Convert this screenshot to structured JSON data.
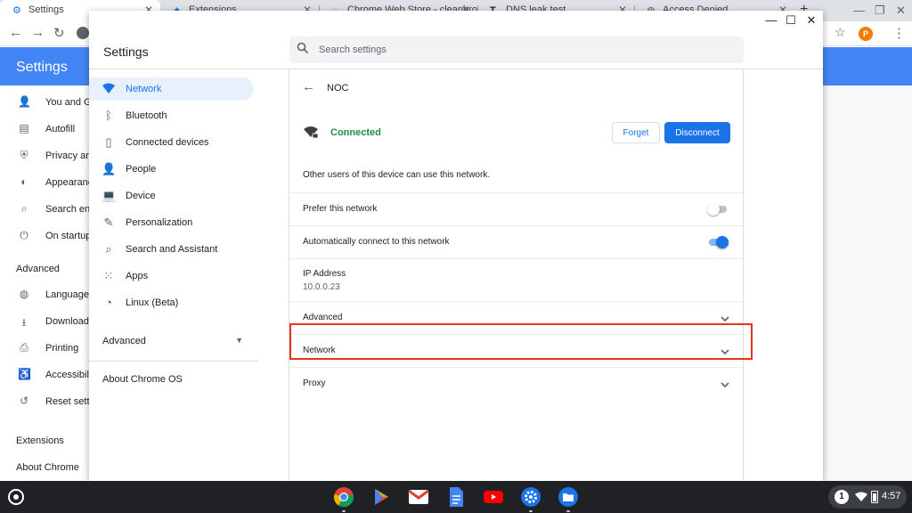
{
  "browser": {
    "tabs": [
      {
        "title": "Settings",
        "icon": "settings-gear-icon"
      },
      {
        "title": "Extensions",
        "icon": "puzzle-icon"
      },
      {
        "title": "Chrome Web Store - cleanbrow",
        "icon": "web-store-icon"
      },
      {
        "title": "DNS leak test",
        "icon": "text-icon"
      },
      {
        "title": "Access Denied",
        "icon": "globe-icon"
      }
    ],
    "new_tab": "+",
    "min_glyph": "—",
    "max_glyph": "❐",
    "close_glyph": "✕",
    "star_glyph": "☆",
    "menu_glyph": "⋮",
    "back_glyph": "←",
    "forward_glyph": "→",
    "reload_glyph": "↻",
    "extension_glyph": "P"
  },
  "background_settings": {
    "header_title": "Settings",
    "items": [
      {
        "label": "You and Google",
        "icon": "person-icon",
        "glyph": "👤"
      },
      {
        "label": "Autofill",
        "icon": "clipboard-icon",
        "glyph": "▤"
      },
      {
        "label": "Privacy and security",
        "icon": "shield-icon",
        "glyph": "⛨"
      },
      {
        "label": "Appearance",
        "icon": "palette-icon",
        "glyph": "◐"
      },
      {
        "label": "Search engine",
        "icon": "search-icon",
        "glyph": "⌕"
      },
      {
        "label": "On startup",
        "icon": "power-icon",
        "glyph": "⏻"
      }
    ],
    "advanced_label": "Advanced",
    "advanced_items": [
      {
        "label": "Languages",
        "icon": "globe-icon",
        "glyph": "◍"
      },
      {
        "label": "Downloads",
        "icon": "download-icon",
        "glyph": "⭳"
      },
      {
        "label": "Printing",
        "icon": "printer-icon",
        "glyph": "⎙"
      },
      {
        "label": "Accessibility",
        "icon": "accessibility-icon",
        "glyph": "♿"
      },
      {
        "label": "Reset settings",
        "icon": "history-icon",
        "glyph": "↺"
      }
    ],
    "extensions_label": "Extensions",
    "about_label": "About Chrome"
  },
  "settings_window": {
    "title": "Settings",
    "minimize": "—",
    "maximize": "☐",
    "close": "✕",
    "search_placeholder": "Search settings",
    "search_value": "",
    "nav": [
      {
        "label": "Network",
        "icon": "wifi-icon",
        "glyph": "▼",
        "active": true
      },
      {
        "label": "Bluetooth",
        "icon": "bluetooth-icon",
        "glyph": "ᛒ"
      },
      {
        "label": "Connected devices",
        "icon": "phone-icon",
        "glyph": "▯"
      },
      {
        "label": "People",
        "icon": "person-icon",
        "glyph": "👤"
      },
      {
        "label": "Device",
        "icon": "laptop-icon",
        "glyph": "💻"
      },
      {
        "label": "Personalization",
        "icon": "brush-icon",
        "glyph": "✎"
      },
      {
        "label": "Search and Assistant",
        "icon": "search-icon",
        "glyph": "⌕"
      },
      {
        "label": "Apps",
        "icon": "apps-grid-icon",
        "glyph": "⁙"
      },
      {
        "label": "Linux (Beta)",
        "icon": "linux-icon",
        "glyph": "◔"
      }
    ],
    "nav_advanced": "Advanced",
    "nav_about": "About Chrome OS"
  },
  "network_detail": {
    "back_glyph": "←",
    "network_name": "NOC",
    "status": "Connected",
    "forget_label": "Forget",
    "disconnect_label": "Disconnect",
    "info_text": "Other users of this device can use this network.",
    "prefer_label": "Prefer this network",
    "prefer_enabled": false,
    "auto_connect_label": "Automatically connect to this network",
    "auto_connect_enabled": true,
    "ip_label": "IP Address",
    "ip_value": "10.0.0.23",
    "sections": [
      {
        "label": "Advanced"
      },
      {
        "label": "Network",
        "highlighted": true
      },
      {
        "label": "Proxy"
      }
    ],
    "highlight_color": "#e8341c"
  },
  "shelf": {
    "apps": [
      {
        "name": "chrome-icon",
        "color": "#db4437"
      },
      {
        "name": "play-store-icon",
        "color": "#ffffff"
      },
      {
        "name": "gmail-icon",
        "color": "#ffffff"
      },
      {
        "name": "docs-icon",
        "color": "#4285f4"
      },
      {
        "name": "youtube-icon",
        "color": "#ff0000"
      },
      {
        "name": "settings-icon",
        "color": "#1a73e8"
      },
      {
        "name": "files-icon",
        "color": "#1a73e8"
      }
    ],
    "notification_count": "1",
    "time": "4:57"
  },
  "colors": {
    "accent": "#1a73e8",
    "header_blue": "#4285f4",
    "connected_green": "#1e8e3e"
  }
}
